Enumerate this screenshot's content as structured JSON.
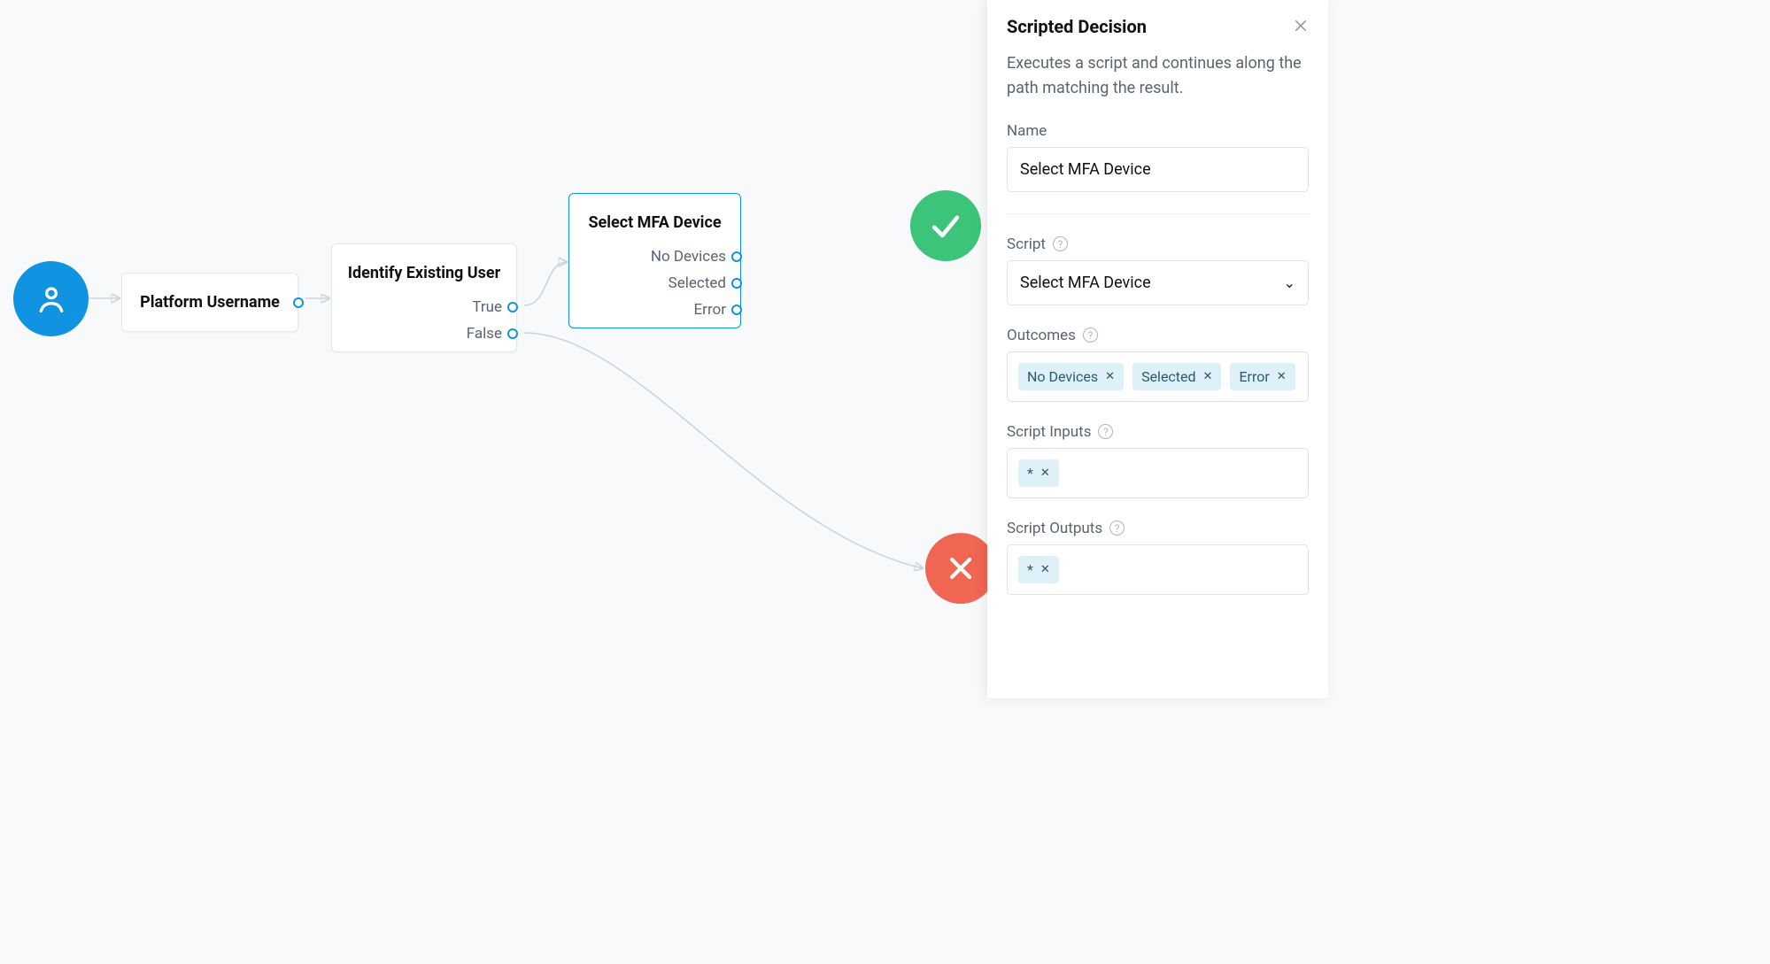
{
  "flow": {
    "startIcon": "user-icon",
    "nodes": {
      "platform_username": {
        "title": "Platform Username"
      },
      "identify_existing_user": {
        "title": "Identify Existing User",
        "outputs": [
          "True",
          "False"
        ]
      },
      "select_mfa_device": {
        "title": "Select MFA Device",
        "outputs": [
          "No Devices",
          "Selected",
          "Error"
        ]
      }
    },
    "results": {
      "success": "check-icon",
      "failure": "cross-icon"
    }
  },
  "panel": {
    "title": "Scripted Decision",
    "description": "Executes a script and continues along the path matching the result.",
    "labels": {
      "name": "Name",
      "script": "Script",
      "outcomes": "Outcomes",
      "inputs": "Script Inputs",
      "outputs": "Script Outputs"
    },
    "name_value": "Select MFA Device",
    "script_selected": "Select MFA Device",
    "outcomes": [
      "No Devices",
      "Selected",
      "Error"
    ],
    "inputs": [
      "*"
    ],
    "outputs": [
      "*"
    ]
  }
}
